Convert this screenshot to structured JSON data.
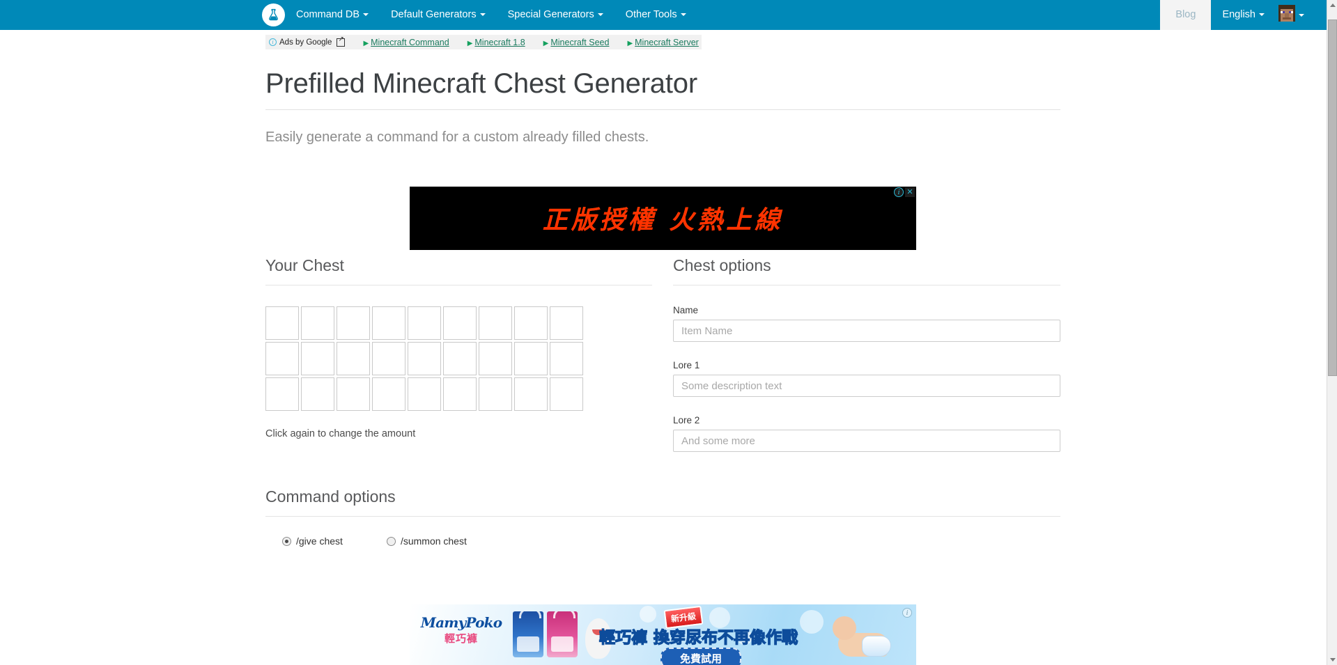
{
  "navbar": {
    "brand_icon": "flask-icon",
    "items": [
      {
        "label": "Command DB",
        "has_caret": true
      },
      {
        "label": "Default Generators",
        "has_caret": true
      },
      {
        "label": "Special Generators",
        "has_caret": true
      },
      {
        "label": "Other Tools",
        "has_caret": true
      }
    ],
    "blog_label": "Blog",
    "language_label": "English",
    "avatar_icon": "minecraft-steve-avatar",
    "background_color": "#0089b8",
    "active_tab_background": "#f4f4f4"
  },
  "ads_strip": {
    "badge_label": "Ads by Google",
    "info_icon": "info-icon",
    "external_icon": "external-link-icon",
    "links": [
      "Minecraft Command",
      "Minecraft 1.8",
      "Minecraft Seed",
      "Minecraft Server"
    ],
    "link_color": "#1a7a5e"
  },
  "header": {
    "title": "Prefilled Minecraft Chest Generator",
    "subtitle": "Easily generate a command for a custom already filled chests."
  },
  "top_ad": {
    "text": "正版授權 火熱上線",
    "background_color": "#000000",
    "text_color": "#ff3300",
    "info_icon": "info-icon",
    "close_icon": "close-icon"
  },
  "chest": {
    "section_title": "Your Chest",
    "rows": 3,
    "columns": 9,
    "slots": [
      [
        "",
        "",
        "",
        "",
        "",
        "",
        "",
        "",
        ""
      ],
      [
        "",
        "",
        "",
        "",
        "",
        "",
        "",
        "",
        ""
      ],
      [
        "",
        "",
        "",
        "",
        "",
        "",
        "",
        "",
        ""
      ]
    ],
    "hint": "Click again to change the amount"
  },
  "chest_options": {
    "section_title": "Chest options",
    "fields": [
      {
        "label": "Name",
        "placeholder": "Item Name",
        "value": ""
      },
      {
        "label": "Lore 1",
        "placeholder": "Some description text",
        "value": ""
      },
      {
        "label": "Lore 2",
        "placeholder": "And some more",
        "value": ""
      }
    ]
  },
  "command_options": {
    "section_title": "Command options",
    "radios": [
      {
        "label": "/give chest",
        "checked": true
      },
      {
        "label": "/summon chest",
        "checked": false
      }
    ]
  },
  "bottom_ad": {
    "brand": "MamyPoko",
    "brand_sub": "輕巧褲",
    "badge": "新升級",
    "headline_highlight": "輕巧褲",
    "headline": "換穿尿布不再像作戰",
    "cta": "免費試用",
    "info_icon": "info-icon"
  },
  "scrollbar": {
    "up_icon": "chevron-up-icon",
    "down_icon": "chevron-down-icon"
  }
}
